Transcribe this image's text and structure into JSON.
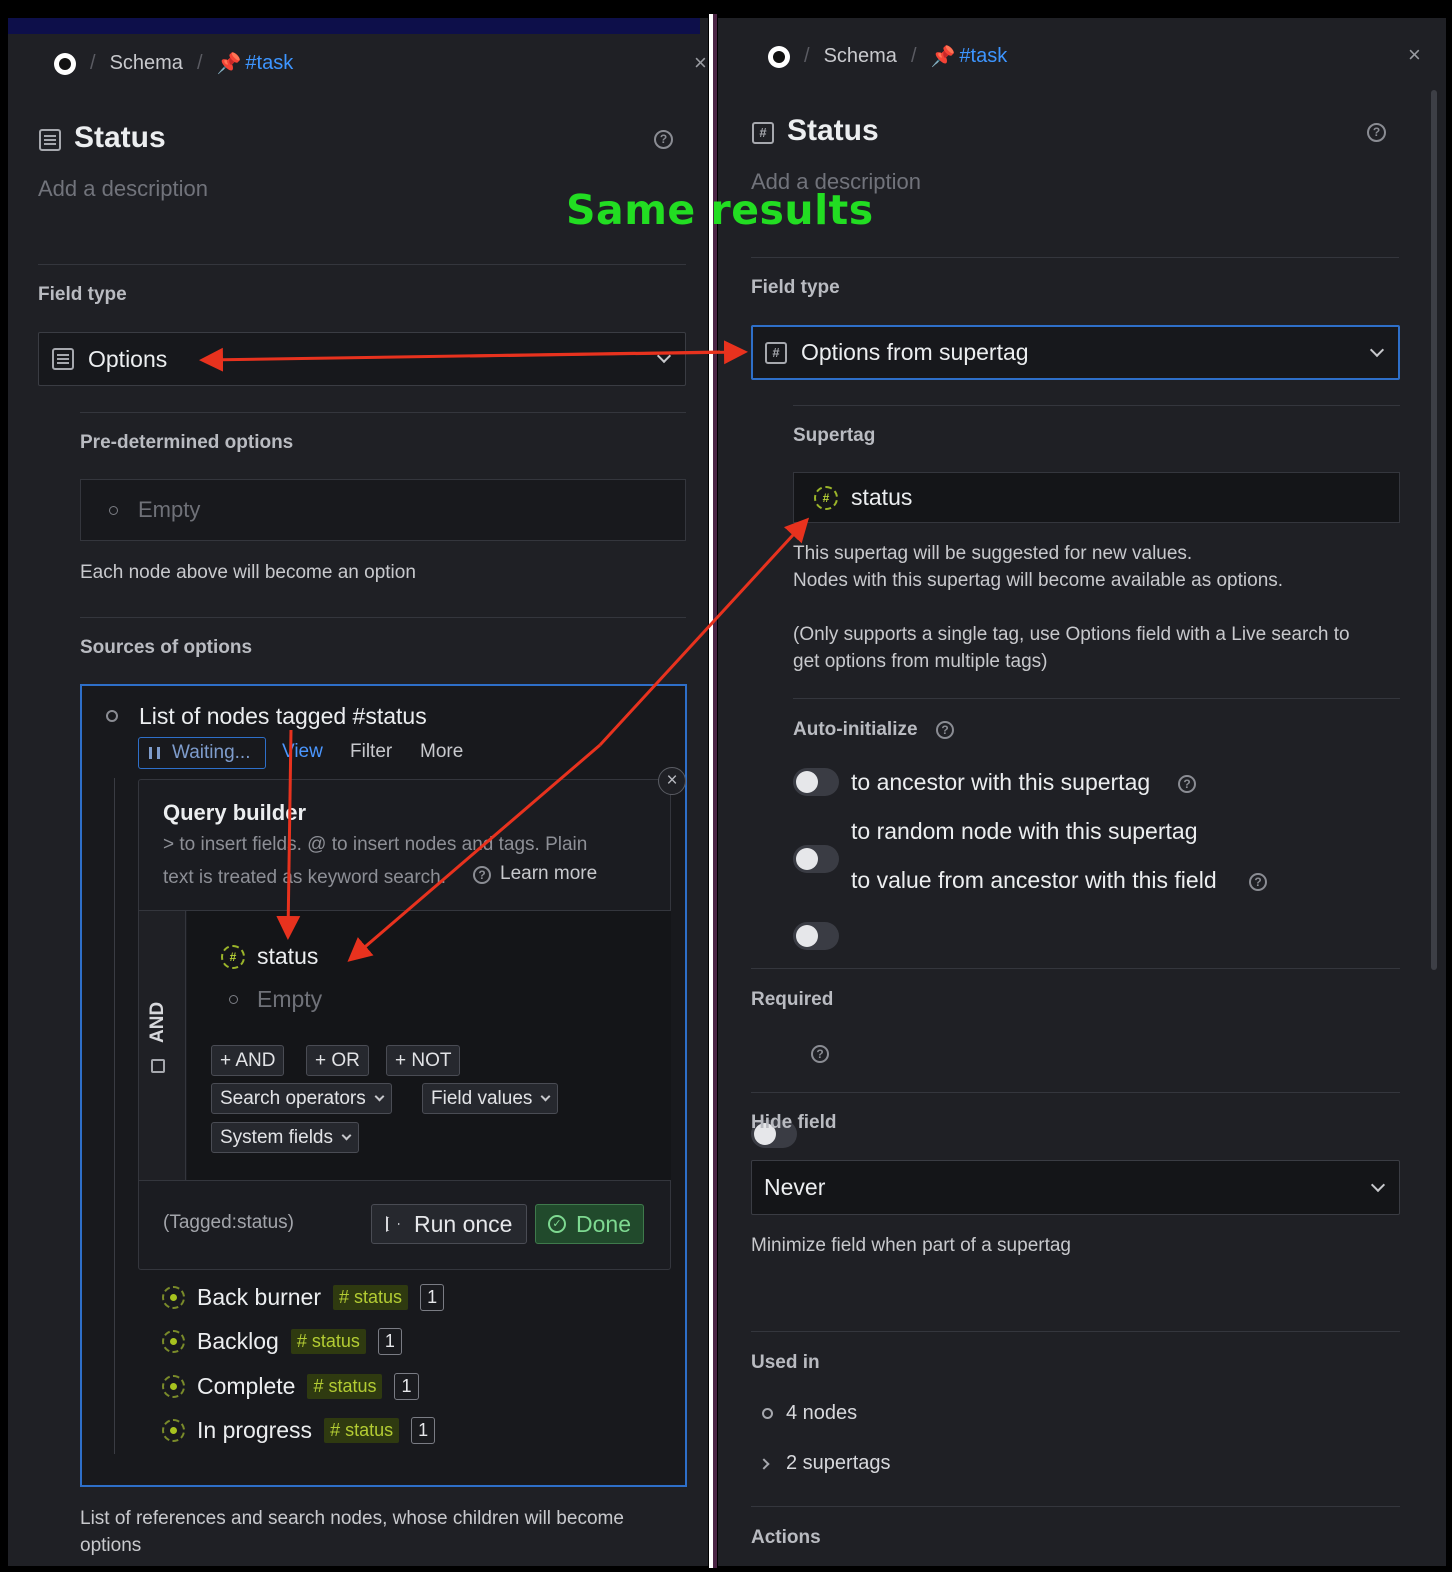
{
  "annotation": {
    "text": "Same results"
  },
  "left": {
    "breadcrumb": {
      "schema": "Schema",
      "tag": "#task"
    },
    "title": "Status",
    "description_placeholder": "Add a description",
    "field_type_label": "Field type",
    "field_type_value": "Options",
    "predetermined_label": "Pre-determined options",
    "predetermined_empty": "Empty",
    "predetermined_hint": "Each node above will become an option",
    "sources_label": "Sources of options",
    "search": {
      "title": "List of nodes tagged #status",
      "waiting": "Waiting...",
      "view": "View",
      "filter": "Filter",
      "more": "More"
    },
    "query_builder": {
      "title": "Query builder",
      "hint_line1": "> to insert fields. @ to insert nodes and tags. Plain",
      "hint_line2": "text is treated as keyword search.",
      "learn_more": "Learn more",
      "and_label": "AND",
      "tag_item": "status",
      "empty": "Empty",
      "btn_and": "+ AND",
      "btn_or": "+ OR",
      "btn_not": "+ NOT",
      "search_operators": "Search operators",
      "field_values": "Field values",
      "system_fields": "System fields",
      "query_text": "(Tagged:status)",
      "run_once": "Run once",
      "done": "Done"
    },
    "results": [
      {
        "name": "Back burner",
        "tag": "# status",
        "count": "1"
      },
      {
        "name": "Backlog",
        "tag": "# status",
        "count": "1"
      },
      {
        "name": "Complete",
        "tag": "# status",
        "count": "1"
      },
      {
        "name": "In progress",
        "tag": "# status",
        "count": "1"
      }
    ],
    "sources_hint_line1": "List of references and search nodes, whose children will become",
    "sources_hint_line2": "options"
  },
  "right": {
    "breadcrumb": {
      "schema": "Schema",
      "tag": "#task"
    },
    "title": "Status",
    "description_placeholder": "Add a description",
    "field_type_label": "Field type",
    "field_type_value": "Options from supertag",
    "supertag_label": "Supertag",
    "supertag_value": "status",
    "supertag_hint_line1": "This supertag will be suggested for new values.",
    "supertag_hint_line2": "Nodes with this supertag will become available as options.",
    "supertag_note_line1": "(Only supports a single tag, use Options field with a Live search to",
    "supertag_note_line2": "get options from multiple tags)",
    "auto_init_label": "Auto-initialize",
    "auto_init": [
      {
        "label": "to ancestor with this supertag",
        "on": false
      },
      {
        "label": "to random node with this supertag",
        "on": false
      },
      {
        "label": "to value from ancestor with this field",
        "on": false
      }
    ],
    "required_label": "Required",
    "required_on": false,
    "hide_field_label": "Hide field",
    "hide_field_value": "Never",
    "hide_field_hint": "Minimize field when part of a supertag",
    "used_in_label": "Used in",
    "used_nodes": "4 nodes",
    "used_supertags": "2 supertags",
    "actions_label": "Actions"
  },
  "colors": {
    "accent": "#3d95ff",
    "annotation": "#22dd22",
    "arrow": "#e8321e",
    "tag": "#b3cc33",
    "background": "#1f2025"
  }
}
